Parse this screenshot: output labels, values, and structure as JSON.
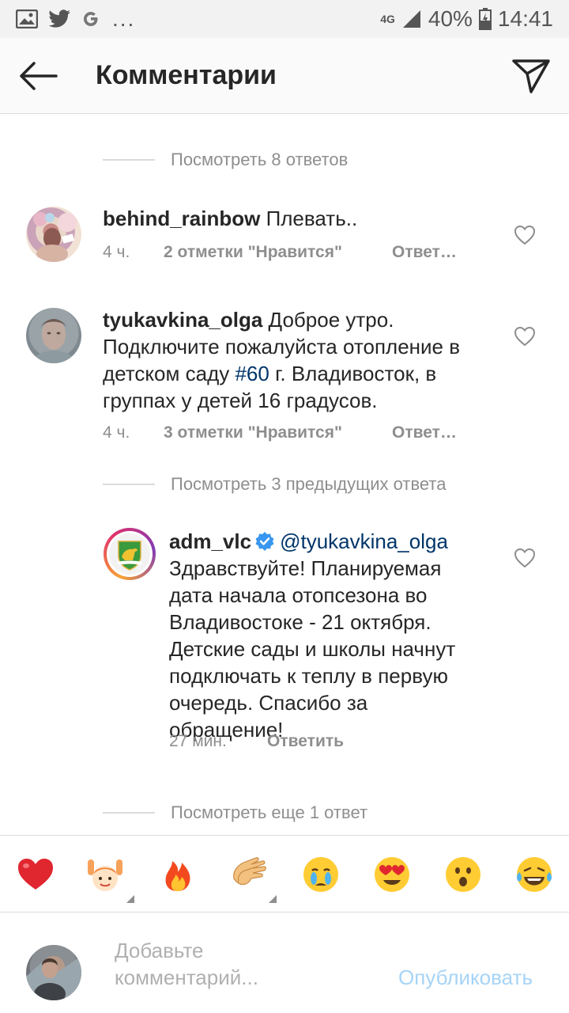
{
  "status_bar": {
    "dots": "...",
    "network": "4G",
    "battery": "40%",
    "time": "14:41"
  },
  "header": {
    "title": "Комментарии"
  },
  "thread": {
    "view_more_top": "Посмотреть 8 ответов",
    "comments": [
      {
        "username": "behind_rainbow",
        "text": "Плевать..",
        "time": "4 ч.",
        "likes": "2 отметки \"Нравится\"",
        "reply": "Ответ…"
      },
      {
        "username": "tyukavkina_olga",
        "text_before": "Доброе утро. Подключите пожалуйста отопление в детском саду ",
        "hashtag": "#60",
        "text_after": " г. Владивосток, в группах у детей 16 градусов.",
        "time": "4 ч.",
        "likes": "3 отметки \"Нравится\"",
        "reply": "Ответ…"
      }
    ],
    "view_previous": "Посмотреть 3 предыдущих ответа",
    "reply": {
      "username": "adm_vlc",
      "mention": "@tyukavkina_olga",
      "text": "Здравствуйте! Планируемая дата начала отопсезона во Владивостоке - 21 октября. Детские сады и школы начнут подключать к теплу в первую очередь. Спасибо за обращение!",
      "time": "27 мин.",
      "reply": "Ответить"
    },
    "view_more_bottom": "Посмотреть еще 1 ответ"
  },
  "emoji_bar": [
    "red-heart",
    "raising-hands",
    "fire",
    "clapping-hands",
    "crying-face",
    "heart-eyes-face",
    "surprised-face",
    "tears-of-joy-face"
  ],
  "input": {
    "placeholder": "Добавьте комментарий...",
    "publish_label": "Опубликовать"
  },
  "colors": {
    "link": "#003569",
    "verified": "#3897f0",
    "publish_disabled": "#a6d4f7",
    "secondary_text": "#8e8e8e"
  }
}
